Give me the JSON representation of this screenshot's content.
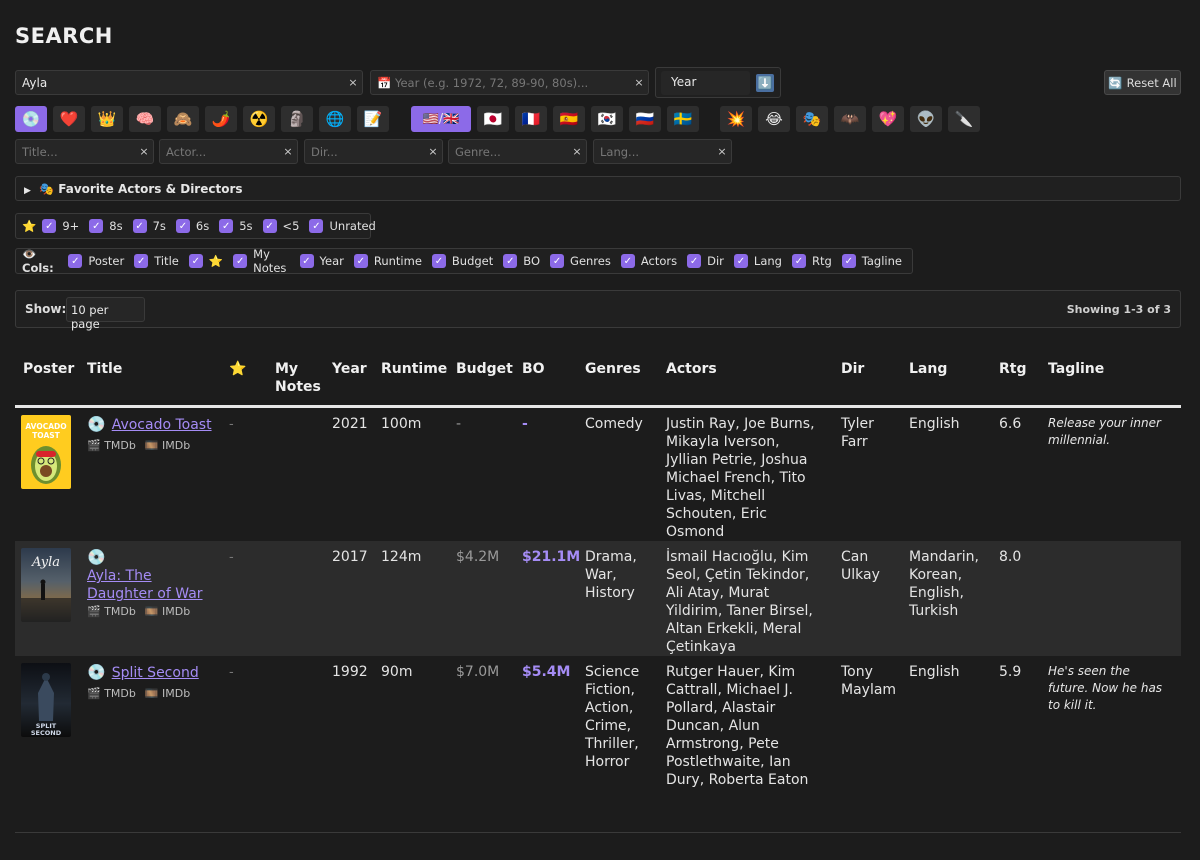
{
  "page_title": "SEARCH",
  "search": {
    "query_value": "Ayla",
    "year_placeholder": "📅 Year (e.g. 1972, 72, 89-90, 80s)...",
    "sort_value": "Year",
    "sort_dir_icon": "⬇️",
    "reset_label": "Reset All",
    "reset_icon": "🔄",
    "clear_glyph": "×"
  },
  "category_chips": [
    "💿",
    "❤️",
    "👑",
    "🧠",
    "🙈",
    "🌶️",
    "☢️",
    "🗿",
    "🌐",
    "📝"
  ],
  "country_chips": [
    "🇺🇸/🇬🇧",
    "🇯🇵",
    "🇫🇷",
    "🇪🇸",
    "🇰🇷",
    "🇷🇺",
    "🇸🇪"
  ],
  "genre_chips": [
    "💥",
    "😂",
    "🎭",
    "🦇",
    "💖",
    "👽",
    "🔪"
  ],
  "filters": {
    "title_placeholder": "Title...",
    "actor_placeholder": "Actor...",
    "dir_placeholder": "Dir...",
    "genre_placeholder": "Genre...",
    "lang_placeholder": "Lang..."
  },
  "favorites": {
    "arrow": "▶",
    "label": "🎭 Favorite Actors & Directors"
  },
  "ratings": {
    "icon": "⭐",
    "items": [
      "9+",
      "8s",
      "7s",
      "6s",
      "5s",
      "<5",
      "Unrated"
    ]
  },
  "cols": {
    "label": "👁️ Cols:",
    "items": [
      "Poster",
      "Title",
      "⭐",
      "My Notes",
      "Year",
      "Runtime",
      "Budget",
      "BO",
      "Genres",
      "Actors",
      "Dir",
      "Lang",
      "Rtg",
      "Tagline"
    ]
  },
  "check_glyph": "✓",
  "paging": {
    "show_label": "Show:",
    "per_page": "10 per page",
    "showing": "Showing 1-3 of 3"
  },
  "table": {
    "headers": [
      "Poster",
      "Title",
      "⭐",
      "My Notes",
      "Year",
      "Runtime",
      "Budget",
      "BO",
      "Genres",
      "Actors",
      "Dir",
      "Lang",
      "Rtg",
      "Tagline"
    ],
    "link_tmdb": "🎬 TMDb",
    "link_imdb": "🎞️ IMDb",
    "disc_icon": "💿",
    "rows": [
      {
        "title": "Avocado Toast",
        "star": "-",
        "notes": "",
        "year": "2021",
        "runtime": "100m",
        "budget": "-",
        "bo": "-",
        "genres": "Comedy",
        "actors": "Justin Ray, Joe Burns, Mikayla Iverson, Jyllian Petrie, Joshua Michael French, Tito Livas, Mitchell Schouten, Eric Osmond",
        "dir": "Tyler Farr",
        "lang": "English",
        "rtg": "6.6",
        "tagline": "Release your inner millennial.",
        "poster_text": "AVOCADO TOAST"
      },
      {
        "title": "Ayla: The Daughter of War",
        "star": "-",
        "notes": "",
        "year": "2017",
        "runtime": "124m",
        "budget": "$4.2M",
        "bo": "$21.1M",
        "genres": "Drama, War, History",
        "actors": "İsmail Hacıoğlu, Kim Seol, Çetin Tekindor, Ali Atay, Murat Yildirim, Taner Birsel, Altan Erkekli, Meral Çetinkaya",
        "dir": "Can Ulkay",
        "lang": "Mandarin, Korean, English, Turkish",
        "rtg": "8.0",
        "tagline": "",
        "poster_text": "Ayla"
      },
      {
        "title": "Split Second",
        "star": "-",
        "notes": "",
        "year": "1992",
        "runtime": "90m",
        "budget": "$7.0M",
        "bo": "$5.4M",
        "genres": "Science Fiction, Action, Crime, Thriller, Horror",
        "actors": "Rutger Hauer, Kim Cattrall, Michael J. Pollard, Alastair Duncan, Alun Armstrong, Pete Postlethwaite, Ian Dury, Roberta Eaton",
        "dir": "Tony Maylam",
        "lang": "English",
        "rtg": "5.9",
        "tagline": "He's seen the future. Now he has to kill it.",
        "poster_text": "SPLIT SECOND"
      }
    ]
  },
  "colors": {
    "accent": "#8c6ae8",
    "link": "#a58cf5",
    "background": "#1c1c1c"
  }
}
